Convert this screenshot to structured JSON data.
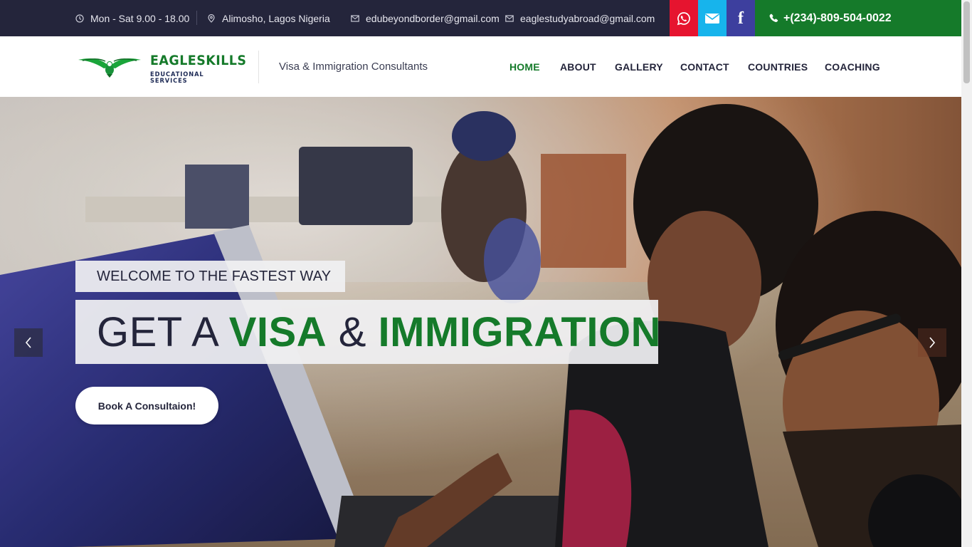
{
  "topbar": {
    "hours": "Mon - Sat 9.00 - 18.00",
    "location": "Alimosho, Lagos Nigeria",
    "email1": "edubeyondborder@gmail.com",
    "email2": "eaglestudyabroad@gmail.com",
    "phone": "+(234)-809-504-0022",
    "social": [
      "whatsapp-icon",
      "envelope-icon",
      "facebook-icon"
    ],
    "colors": {
      "bar": "#24253b",
      "whatsapp": "#e6142f",
      "mail": "#17b4ec",
      "facebook": "#3d3f9e",
      "phone": "#157a2a"
    }
  },
  "header": {
    "logo_name": "EAGLESKILLS",
    "logo_sub": "EDUCATIONAL SERVICES",
    "tagline": "Visa & Immigration Consultants",
    "nav": [
      {
        "label": "HOME",
        "active": true
      },
      {
        "label": "ABOUT"
      },
      {
        "label": "GALLERY"
      },
      {
        "label": "CONTACT"
      },
      {
        "label": "COUNTRIES"
      },
      {
        "label": "COACHING"
      }
    ]
  },
  "hero": {
    "eyebrow": "WELCOME TO THE FASTEST WAY",
    "headline": {
      "part1": "GET A ",
      "part2": "VISA",
      "part3": " & ",
      "part4": "IMMIGRATION"
    },
    "cta": "Book A Consultaion!",
    "accent": "#157a2a"
  }
}
